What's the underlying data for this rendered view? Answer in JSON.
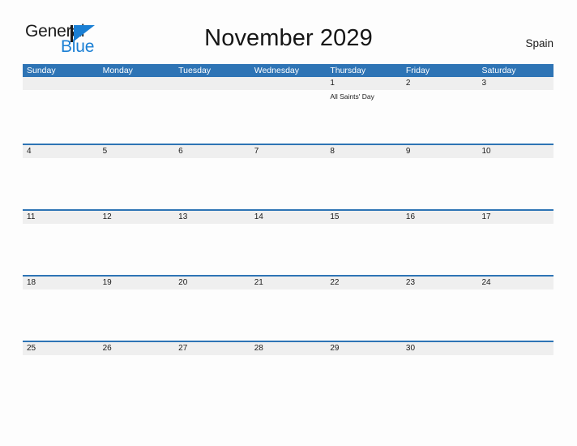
{
  "brand": {
    "word_one": "General",
    "word_two": "Blue",
    "triangle_color": "#1a7fd4",
    "text_color": "#1b1b1b"
  },
  "header": {
    "title": "November 2029",
    "region": "Spain"
  },
  "theme": {
    "header_blue": "#2e74b5",
    "row_band_gray": "#efefef",
    "rule_blue": "#2e74b5",
    "page_background": "#fdfdfd",
    "text": "#1b1b1b"
  },
  "calendar": {
    "weekdays": [
      "Sunday",
      "Monday",
      "Tuesday",
      "Wednesday",
      "Thursday",
      "Friday",
      "Saturday"
    ],
    "weeks": [
      {
        "days": [
          {
            "number": "",
            "events": []
          },
          {
            "number": "",
            "events": []
          },
          {
            "number": "",
            "events": []
          },
          {
            "number": "",
            "events": []
          },
          {
            "number": "1",
            "events": [
              "All Saints' Day"
            ]
          },
          {
            "number": "2",
            "events": []
          },
          {
            "number": "3",
            "events": []
          }
        ]
      },
      {
        "days": [
          {
            "number": "4",
            "events": []
          },
          {
            "number": "5",
            "events": []
          },
          {
            "number": "6",
            "events": []
          },
          {
            "number": "7",
            "events": []
          },
          {
            "number": "8",
            "events": []
          },
          {
            "number": "9",
            "events": []
          },
          {
            "number": "10",
            "events": []
          }
        ]
      },
      {
        "days": [
          {
            "number": "11",
            "events": []
          },
          {
            "number": "12",
            "events": []
          },
          {
            "number": "13",
            "events": []
          },
          {
            "number": "14",
            "events": []
          },
          {
            "number": "15",
            "events": []
          },
          {
            "number": "16",
            "events": []
          },
          {
            "number": "17",
            "events": []
          }
        ]
      },
      {
        "days": [
          {
            "number": "18",
            "events": []
          },
          {
            "number": "19",
            "events": []
          },
          {
            "number": "20",
            "events": []
          },
          {
            "number": "21",
            "events": []
          },
          {
            "number": "22",
            "events": []
          },
          {
            "number": "23",
            "events": []
          },
          {
            "number": "24",
            "events": []
          }
        ]
      },
      {
        "days": [
          {
            "number": "25",
            "events": []
          },
          {
            "number": "26",
            "events": []
          },
          {
            "number": "27",
            "events": []
          },
          {
            "number": "28",
            "events": []
          },
          {
            "number": "29",
            "events": []
          },
          {
            "number": "30",
            "events": []
          },
          {
            "number": "",
            "events": []
          }
        ]
      }
    ]
  }
}
